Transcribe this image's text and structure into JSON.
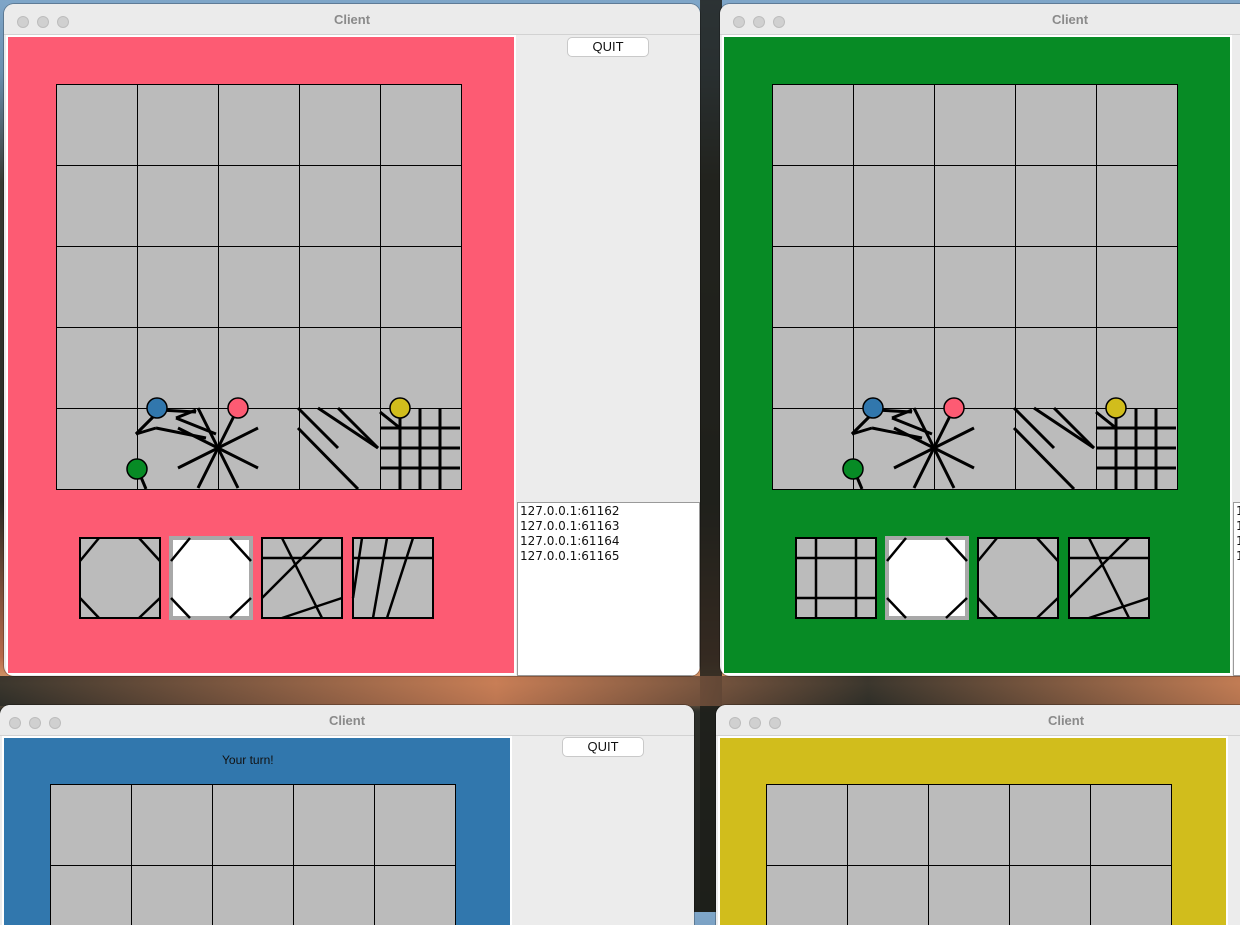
{
  "windows": [
    {
      "title": "Client",
      "quit_label": "QUIT",
      "panel_color": "#fd5b73",
      "log": [
        "127.0.0.1:61162",
        "127.0.0.1:61163",
        "127.0.0.1:61164",
        "127.0.0.1:61165"
      ]
    },
    {
      "title": "Client",
      "panel_color": "#078b25",
      "log": [
        "1",
        "1",
        "1",
        "1"
      ]
    },
    {
      "title": "Client",
      "quit_label": "QUIT",
      "panel_color": "#3177ad",
      "status_text": "Your turn!"
    },
    {
      "title": "Client",
      "panel_color": "#d1bd1c"
    }
  ],
  "colors": {
    "cell": "#bbbbbb",
    "grid_line": "#000000",
    "selected_tile": "#ffffff",
    "blue_marker": "#3177ad",
    "red_marker": "#fd5b73",
    "yellow_marker": "#d1bd1c",
    "green_marker": "#078b25"
  },
  "board": {
    "rows": 5,
    "cols": 5
  },
  "hand": {
    "tile_count": 4,
    "selected_index": 1
  },
  "icons": [
    "close-dot",
    "minimize-dot",
    "zoom-dot"
  ]
}
